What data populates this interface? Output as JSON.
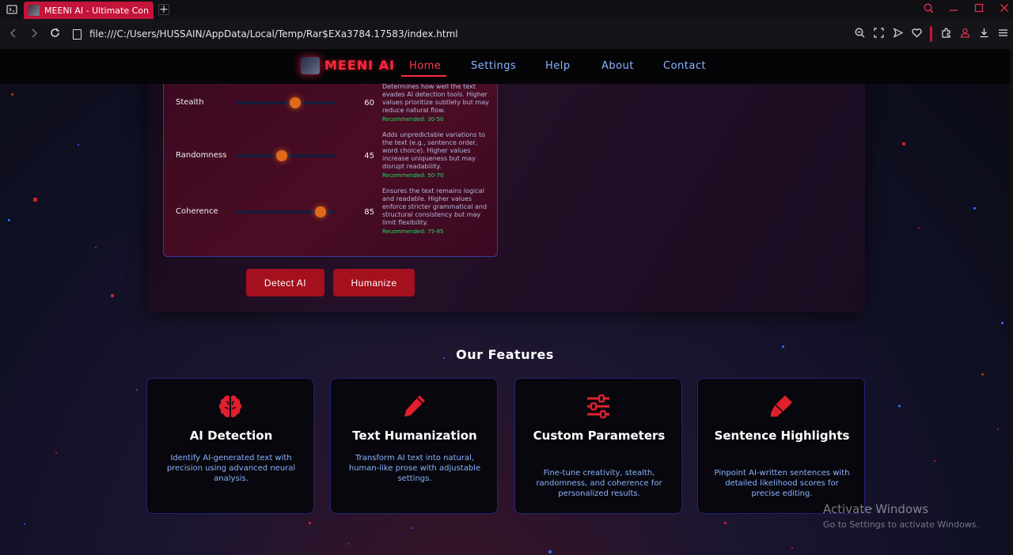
{
  "browser": {
    "tab_title": "MEENI AI - Ultimate Conte",
    "new_tab": "+",
    "url": "file:///C:/Users/HUSSAIN/AppData/Local/Temp/Rar$EXa3784.17583/index.html",
    "accent": "#c4143a"
  },
  "site": {
    "logo": "MEENI AI",
    "nav": [
      "Home",
      "Settings",
      "Help",
      "About",
      "Contact"
    ]
  },
  "params": [
    {
      "label": "Stealth",
      "value": "60",
      "level": 60,
      "desc": "Determines how well the text evades AI detection tools. Higher values prioritize subtlety but may reduce natural flow.",
      "rec": "Recommended: 30-50"
    },
    {
      "label": "Randomness",
      "value": "45",
      "level": 45,
      "desc": "Adds unpredictable variations to the text (e.g., sentence order, word choice). Higher values increase uniqueness but may disrupt readability.",
      "rec": "Recommended: 50-70"
    },
    {
      "label": "Coherence",
      "value": "85",
      "level": 85,
      "desc": "Ensures the text remains logical and readable. Higher values enforce stricter grammatical and structural consistency but may limit flexibility.",
      "rec": "Recommended: 75-85"
    }
  ],
  "buttons": {
    "detect": "Detect AI",
    "humanize": "Humanize"
  },
  "features": {
    "title": "Our Features",
    "items": [
      {
        "title": "AI Detection",
        "desc": "Identify AI-generated text with precision using advanced neural analysis.",
        "icon": "brain-icon"
      },
      {
        "title": "Text Humanization",
        "desc": "Transform AI text into natural, human-like prose with adjustable settings.",
        "icon": "pen-icon"
      },
      {
        "title": "Custom Parameters",
        "desc": "Fine-tune creativity, stealth, randomness, and coherence for personalized results.",
        "icon": "sliders-icon"
      },
      {
        "title": "Sentence Highlights",
        "desc": "Pinpoint AI-written sentences with detailed likelihood scores for precise editing.",
        "icon": "highlighter-icon"
      }
    ]
  },
  "watermark": {
    "line1": "Activate Windows",
    "line2": "Go to Settings to activate Windows."
  }
}
